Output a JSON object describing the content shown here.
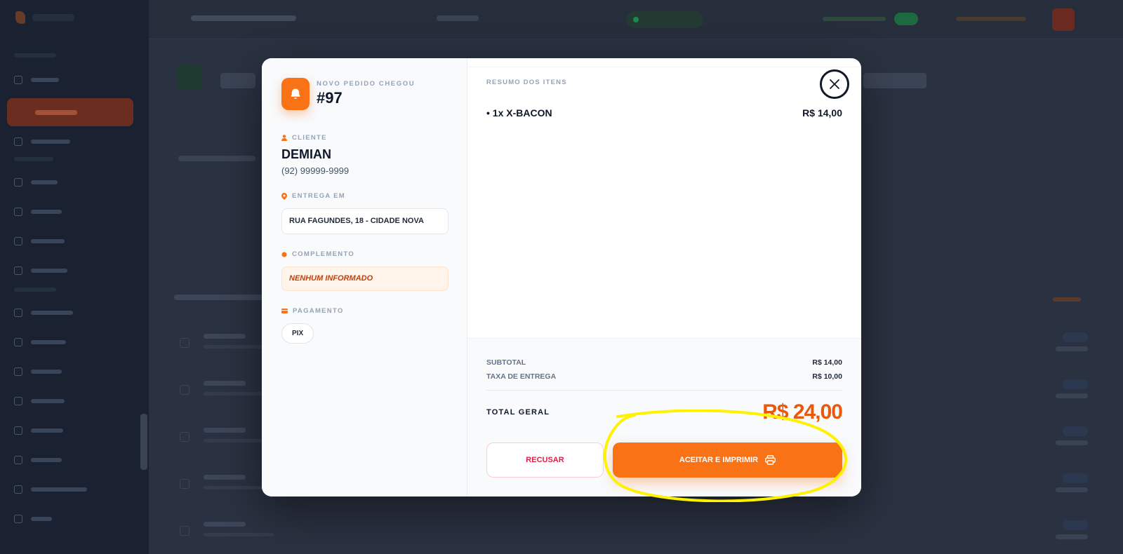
{
  "modal": {
    "eyebrow": "NOVO PEDIDO CHEGOU",
    "order_number": "#97",
    "client_label": "CLIENTE",
    "client_name": "DEMIAN",
    "client_phone": "(92) 99999-9999",
    "delivery_label": "ENTREGA EM",
    "delivery_address": "RUA FAGUNDES, 18 - CIDADE NOVA",
    "complement_label": "COMPLEMENTO",
    "complement_value": "NENHUM INFORMADO",
    "payment_label": "PAGAMENTO",
    "payment_method": "PIX",
    "summary_title": "RESUMO DOS ITENS",
    "items": [
      {
        "name": "• 1x X-BACON",
        "price": "R$ 14,00"
      }
    ],
    "subtotal_label": "SUBTOTAL",
    "subtotal_value": "R$ 14,00",
    "delivery_fee_label": "TAXA DE ENTREGA",
    "delivery_fee_value": "R$ 10,00",
    "total_label": "TOTAL GERAL",
    "total_value": "R$ 24,00",
    "refuse_label": "RECUSAR",
    "accept_label": "ACEITAR E IMPRIMIR"
  },
  "icons": {
    "order": "bell-icon",
    "client": "user-icon",
    "delivery": "map-pin-icon",
    "complement": "dot-icon",
    "payment": "credit-card-icon",
    "close": "close-icon",
    "accept": "printer-icon"
  },
  "colors": {
    "accent": "#f97316",
    "total": "#ea580c",
    "refuse": "#e11d48",
    "overlay": "#2a3140",
    "annotation": "#fff200"
  }
}
